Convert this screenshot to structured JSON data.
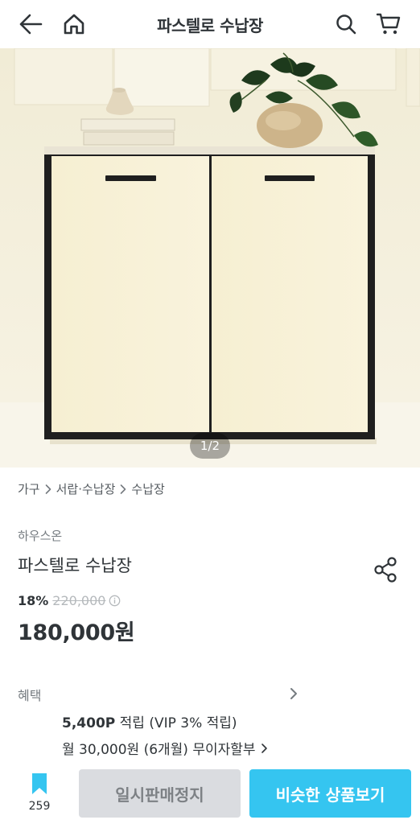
{
  "header": {
    "title": "파스텔로 수납장",
    "back_icon": "arrow-left-icon",
    "home_icon": "home-icon",
    "search_icon": "search-icon",
    "cart_icon": "cart-icon"
  },
  "gallery": {
    "page_indicator": "1/2",
    "current_page": 1,
    "total_pages": 2
  },
  "breadcrumb": [
    "가구",
    "서랍·수납장",
    "수납장"
  ],
  "product": {
    "brand": "하우스온",
    "name": "파스텔로 수납장",
    "discount": "18%",
    "original_price": "220,000",
    "price": "180,000원"
  },
  "benefits": {
    "label": "혜택",
    "points_value": "5,400P",
    "points_text": " 적립 (VIP 3% 적립)",
    "installment": "월 30,000원 (6개월) 무이자할부"
  },
  "bottom_bar": {
    "bookmark_count": "259",
    "soldout_label": "일시판매정지",
    "similar_label": "비슷한 상품보기"
  },
  "colors": {
    "accent": "#35c5f0",
    "text": "#2f3438",
    "muted": "#757b80",
    "disabled_bg": "#dadce0"
  }
}
